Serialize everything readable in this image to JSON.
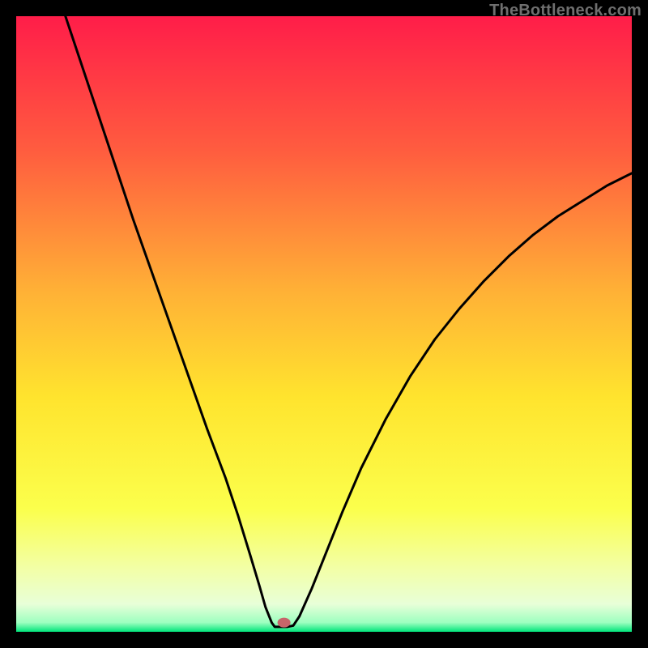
{
  "watermark": "TheBottleneck.com",
  "chart_data": {
    "type": "line",
    "title": "",
    "xlabel": "",
    "ylabel": "",
    "xlim": [
      0,
      100
    ],
    "ylim": [
      0,
      100
    ],
    "minimum_x": 42,
    "marker": {
      "x": 43.5,
      "y": 1.5,
      "color": "#c7656a"
    },
    "gradient_stops": [
      {
        "offset": 0.0,
        "color": "#ff1d49"
      },
      {
        "offset": 0.22,
        "color": "#ff5d3f"
      },
      {
        "offset": 0.45,
        "color": "#ffb236"
      },
      {
        "offset": 0.62,
        "color": "#ffe42e"
      },
      {
        "offset": 0.8,
        "color": "#fbff4c"
      },
      {
        "offset": 0.9,
        "color": "#f2ffa9"
      },
      {
        "offset": 0.955,
        "color": "#e8ffd8"
      },
      {
        "offset": 0.985,
        "color": "#9dffc0"
      },
      {
        "offset": 1.0,
        "color": "#00e47a"
      }
    ],
    "curve_points": [
      {
        "x": 8.0,
        "y": 100.0
      },
      {
        "x": 10.0,
        "y": 94.0
      },
      {
        "x": 13.0,
        "y": 85.0
      },
      {
        "x": 16.0,
        "y": 76.0
      },
      {
        "x": 19.0,
        "y": 67.0
      },
      {
        "x": 22.0,
        "y": 58.5
      },
      {
        "x": 25.0,
        "y": 50.0
      },
      {
        "x": 28.0,
        "y": 41.5
      },
      {
        "x": 31.0,
        "y": 33.0
      },
      {
        "x": 34.0,
        "y": 25.0
      },
      {
        "x": 36.0,
        "y": 19.0
      },
      {
        "x": 38.0,
        "y": 12.5
      },
      {
        "x": 39.5,
        "y": 7.5
      },
      {
        "x": 40.5,
        "y": 4.0
      },
      {
        "x": 41.5,
        "y": 1.5
      },
      {
        "x": 42.0,
        "y": 0.8
      },
      {
        "x": 43.0,
        "y": 0.8
      },
      {
        "x": 44.0,
        "y": 0.8
      },
      {
        "x": 45.0,
        "y": 1.0
      },
      {
        "x": 46.0,
        "y": 2.5
      },
      {
        "x": 48.0,
        "y": 7.0
      },
      {
        "x": 50.0,
        "y": 12.0
      },
      {
        "x": 53.0,
        "y": 19.5
      },
      {
        "x": 56.0,
        "y": 26.5
      },
      {
        "x": 60.0,
        "y": 34.5
      },
      {
        "x": 64.0,
        "y": 41.5
      },
      {
        "x": 68.0,
        "y": 47.5
      },
      {
        "x": 72.0,
        "y": 52.5
      },
      {
        "x": 76.0,
        "y": 57.0
      },
      {
        "x": 80.0,
        "y": 61.0
      },
      {
        "x": 84.0,
        "y": 64.5
      },
      {
        "x": 88.0,
        "y": 67.5
      },
      {
        "x": 92.0,
        "y": 70.0
      },
      {
        "x": 96.0,
        "y": 72.5
      },
      {
        "x": 100.0,
        "y": 74.5
      }
    ]
  }
}
